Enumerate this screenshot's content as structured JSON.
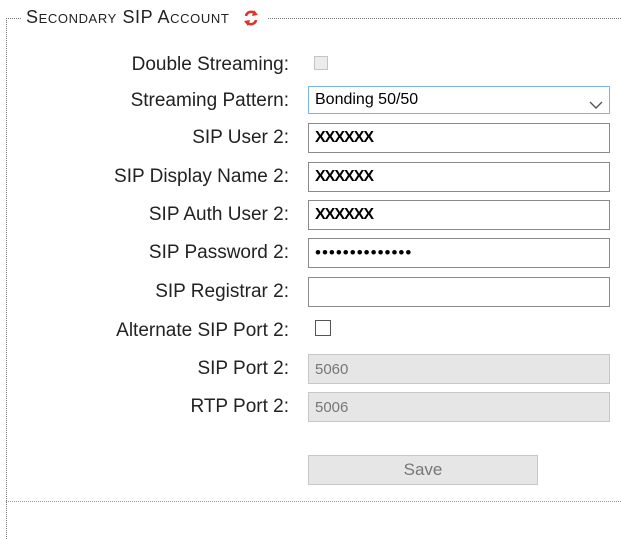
{
  "section": {
    "title": "Secondary SIP Account",
    "refresh_icon": "refresh-icon"
  },
  "fields": {
    "double_streaming": {
      "label": "Double Streaming:",
      "checked": false,
      "disabled": true
    },
    "streaming_pattern": {
      "label": "Streaming Pattern:",
      "value": "Bonding 50/50"
    },
    "sip_user": {
      "label": "SIP User 2:",
      "value": "XXXXXX"
    },
    "sip_display_name": {
      "label": "SIP Display Name 2:",
      "value": "XXXXXX"
    },
    "sip_auth_user": {
      "label": "SIP Auth User 2:",
      "value": "XXXXXX"
    },
    "sip_password": {
      "label": "SIP Password 2:",
      "value": "••••••••••••••"
    },
    "sip_registrar": {
      "label": "SIP Registrar 2:",
      "value": ""
    },
    "alternate_sip_port": {
      "label": "Alternate SIP Port 2:",
      "checked": false
    },
    "sip_port": {
      "label": "SIP Port 2:",
      "value": "5060"
    },
    "rtp_port": {
      "label": "RTP Port 2:",
      "value": "5006"
    }
  },
  "save_label": "Save",
  "colors": {
    "accent_red": "#e0342b",
    "select_border": "#7ab3e6",
    "disabled_bg": "#e6e6e6"
  }
}
